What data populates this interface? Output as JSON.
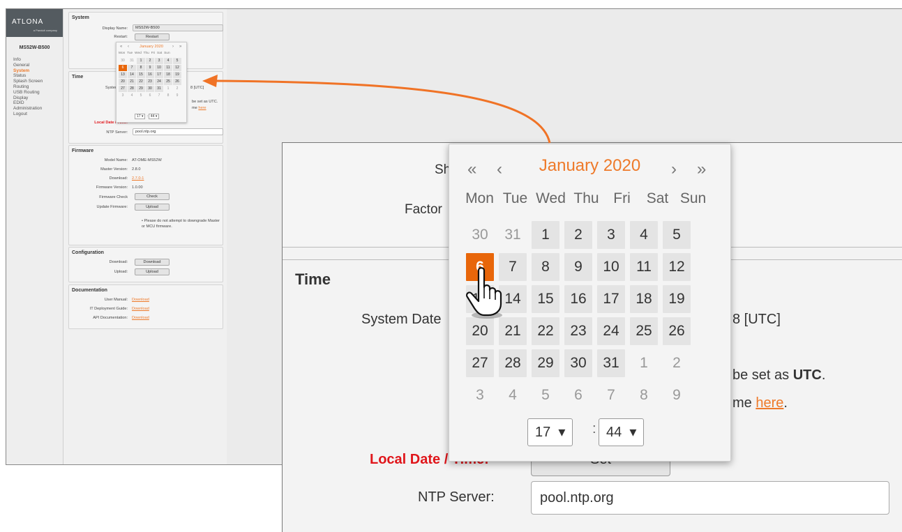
{
  "brand": {
    "name": "ATLONA",
    "tagline": "a Panduit company",
    "accent": "#ee7a2a",
    "selected": "#e8660a",
    "required": "#e0161b"
  },
  "device_name": "MS52W-B500",
  "nav": [
    "Info",
    "General",
    "System",
    "Status",
    "Splash Screen",
    "Routing",
    "USB Routing",
    "Display",
    "EDID",
    "Administration",
    "Logout"
  ],
  "active_nav": "System",
  "system": {
    "title": "System",
    "display_name_label": "Display Name:",
    "display_name_value": "MS52W-B500",
    "restart_label": "Restart:",
    "restart_button": "Restart",
    "shutdown_label_partial": "Sh",
    "factory_label_partial": "Factor"
  },
  "time": {
    "title": "Time",
    "system_date_label_partial": "System Date",
    "system_date_value_partial": "8 [UTC]",
    "utc_note_partial_a": "be set as ",
    "utc_note_strong": "UTC",
    "utc_note_end": ".",
    "tz_note_partial": "me ",
    "tz_link": "here",
    "tz_end": ".",
    "local_label_partial": "Local Date / Time:",
    "set_button": "Set",
    "ntp_label": "NTP Server:",
    "ntp_value": "pool.ntp.org"
  },
  "firmware": {
    "title": "Firmware",
    "model_label": "Model Name:",
    "model_value": "AT-OME-MS52W",
    "master_label": "Master Version:",
    "master_value": "2.8.0",
    "download_label": "Download:",
    "download_value": "2.7.0-1",
    "fw_label": "Firmware Version:",
    "fw_value": "1.0.00",
    "check_label": "Firmware Check",
    "check_button": "Check",
    "update_label": "Update Firmware:",
    "update_button": "Upload",
    "note": "Please do not attempt to downgrade Master or MCU firmware."
  },
  "configuration": {
    "title": "Configuration",
    "download_label": "Download:",
    "download_button": "Download",
    "upload_label": "Upload:",
    "upload_button": "Upload"
  },
  "documentation": {
    "title": "Documentation",
    "items": [
      {
        "label": "User Manual:",
        "link": "Download"
      },
      {
        "label": "IT Deployment Guide:",
        "link": "Download"
      },
      {
        "label": "API Documentation:",
        "link": "Download"
      }
    ]
  },
  "datepicker": {
    "month_title": "January 2020",
    "nav_prev_year": "«",
    "nav_prev": "‹",
    "nav_next": "›",
    "nav_next_year": "»",
    "weekdays": [
      "Mon",
      "Tue",
      "Wed",
      "Thu",
      "Fri",
      "Sat",
      "Sun"
    ],
    "days": [
      {
        "d": "30",
        "o": 1
      },
      {
        "d": "31",
        "o": 1
      },
      {
        "d": "1"
      },
      {
        "d": "2"
      },
      {
        "d": "3"
      },
      {
        "d": "4"
      },
      {
        "d": "5"
      },
      {
        "d": "6",
        "s": 1
      },
      {
        "d": "7"
      },
      {
        "d": "8"
      },
      {
        "d": "9"
      },
      {
        "d": "10"
      },
      {
        "d": "11"
      },
      {
        "d": "12"
      },
      {
        "d": "13"
      },
      {
        "d": "14"
      },
      {
        "d": "15"
      },
      {
        "d": "16"
      },
      {
        "d": "17"
      },
      {
        "d": "18"
      },
      {
        "d": "19"
      },
      {
        "d": "20"
      },
      {
        "d": "21"
      },
      {
        "d": "22"
      },
      {
        "d": "23"
      },
      {
        "d": "24"
      },
      {
        "d": "25"
      },
      {
        "d": "26"
      },
      {
        "d": "27"
      },
      {
        "d": "28"
      },
      {
        "d": "29"
      },
      {
        "d": "30"
      },
      {
        "d": "31"
      },
      {
        "d": "1",
        "o": 1
      },
      {
        "d": "2",
        "o": 1
      },
      {
        "d": "3",
        "o": 1
      },
      {
        "d": "4",
        "o": 1
      },
      {
        "d": "5",
        "o": 1
      },
      {
        "d": "6",
        "o": 1
      },
      {
        "d": "7",
        "o": 1
      },
      {
        "d": "8",
        "o": 1
      },
      {
        "d": "9",
        "o": 1
      }
    ],
    "hour": "17",
    "minute": "44",
    "select_arrow": "▾",
    "colon": ":"
  }
}
